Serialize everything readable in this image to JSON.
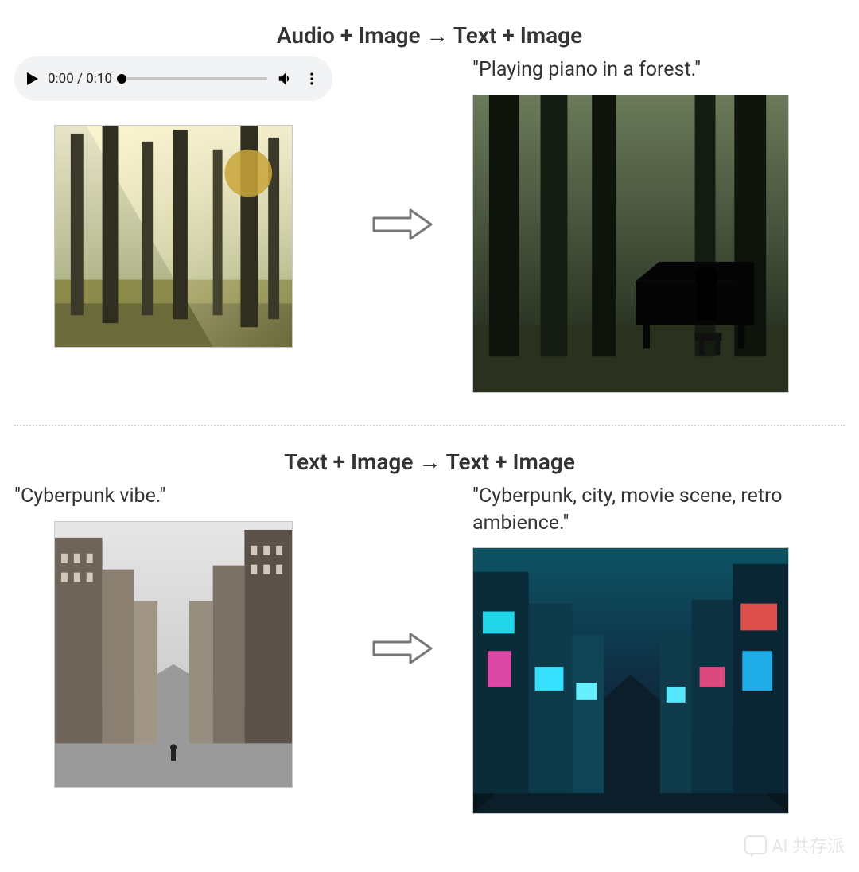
{
  "section1": {
    "title": "Audio + Image → Text + Image",
    "audio": {
      "current_time": "0:00",
      "total_time": "0:10",
      "time_display": "0:00 / 0:10"
    },
    "input_image_alt": "forest with sunlight through trees",
    "output_caption": "\"Playing piano in a forest.\"",
    "output_image_alt": "person playing grand piano in dark forest"
  },
  "section2": {
    "title": "Text + Image → Text + Image",
    "input_caption": "\"Cyberpunk vibe.\"",
    "input_image_alt": "city street between tall buildings",
    "output_caption": "\"Cyberpunk, city, movie scene, retro ambience.\"",
    "output_image_alt": "neon cyberpunk city street scene"
  },
  "watermark": "AI 共存派"
}
